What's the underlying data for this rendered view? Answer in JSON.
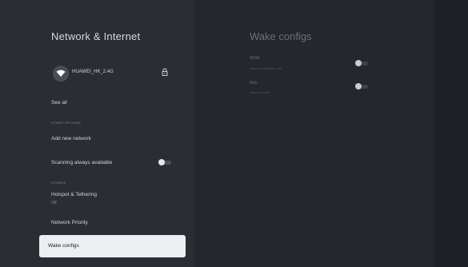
{
  "settings": {
    "title": "Network & Internet",
    "wifi": {
      "network_name": "HUAWEI_HK_2.4G",
      "icon": "wifi-icon",
      "secured_icon": "lock-icon"
    },
    "see_all_label": "See all",
    "other_options_label": "OTHER OPTIONS",
    "add_new_network_label": "Add new network",
    "scanning_label": "Scanning always available",
    "scanning_toggle_on": true,
    "others_label": "OTHERS",
    "hotspot_label": "Hotspot & Tethering",
    "hotspot_status": "Off",
    "network_priority_label": "Network Priority",
    "wake_configs_label": "Wake configs"
  },
  "wake_panel": {
    "title": "Wake configs",
    "options": [
      {
        "title": "WoW",
        "subtitle": "Wake on Wireless LAN",
        "enabled": false
      },
      {
        "title": "WoL",
        "subtitle": "Wake on LAN",
        "enabled": false
      }
    ]
  },
  "colors": {
    "left_panel_bg": "#2a2d32",
    "right_panel_bg": "#24272b",
    "selected_bg": "#eceef1"
  }
}
